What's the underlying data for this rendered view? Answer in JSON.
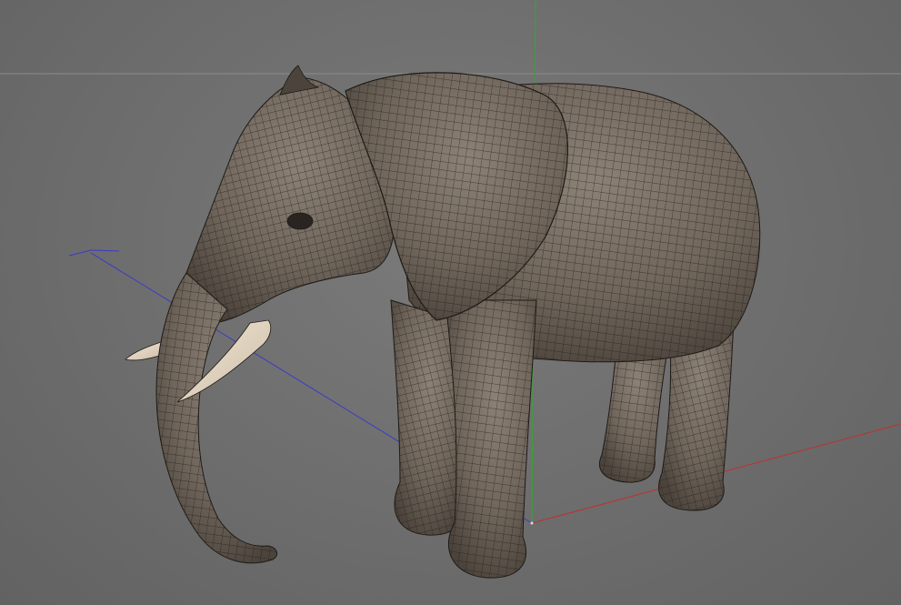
{
  "viewport": {
    "background_color": "#6e6e6e",
    "horizon_line_color": "#8c8c8c"
  },
  "axes": {
    "x_axis": {
      "color": "#c03030"
    },
    "y_axis": {
      "color": "#2fa82f"
    },
    "z_axis": {
      "color": "#3a3ac8"
    }
  },
  "model": {
    "skin_color": "#6f655b",
    "skin_highlight": "#8b8176",
    "wire_color": "#1e1a16",
    "tusk_color": "#e8dccb"
  }
}
